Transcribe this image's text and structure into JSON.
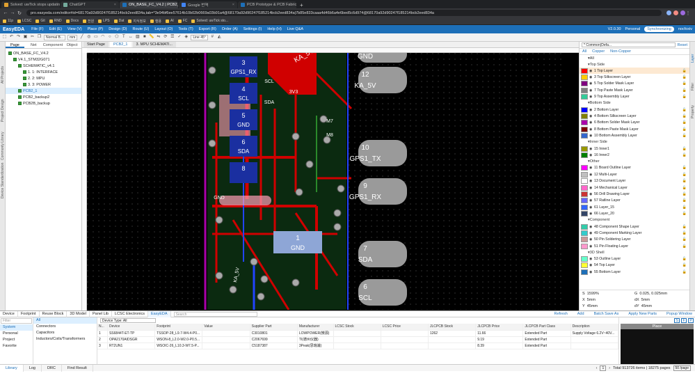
{
  "browser": {
    "tabs": [
      {
        "label": "Solved: uwTick stops updating...",
        "color": "#e0a030",
        "active": false
      },
      {
        "label": "ChatGPT",
        "color": "#74aa9c",
        "active": false
      },
      {
        "label": "ON_BASE_FC_V4.2 | PCB2_1 | Ea...",
        "color": "#1d6fb8",
        "active": true
      },
      {
        "label": "Google 번역",
        "color": "#4285f4",
        "active": false
      },
      {
        "label": "PCB Prototype & PCB Fabricati...",
        "color": "#1d6fb8",
        "active": false
      }
    ],
    "new_tab": "+",
    "url": "pro.easyeda.com/editor#id=68170a92d90247f185214bcb2eed834a,tab=*3e94bf6ee57614b10b02b0669a03b91a4@68170a92d90247f185214bcb2eed834a|7b85e833caaa4d46b6a4e6bed5c6d974@68170a92d90247f185214bcb2eed834a",
    "bookmarks": [
      "11p",
      "LCSC",
      "Git",
      "RND",
      "Docs",
      "전원",
      "LPS",
      "Dat",
      "지식정보",
      "행용",
      "AI",
      "FC",
      "Solved: uwTick sto..."
    ]
  },
  "app": {
    "logo": "EasyEDA",
    "menus": [
      "File (F)",
      "Edit (E)",
      "View (V)",
      "Place (P)",
      "Design (D)",
      "Route (U)",
      "Layout (O)",
      "Tools (T)",
      "Export (R)",
      "Order (A)",
      "Settings (I)",
      "Help (H)",
      "Live Q&A"
    ],
    "version": "V2.0.30",
    "plan": "Personal",
    "sync": "Synchronizing",
    "user": "nocfoxiv"
  },
  "toolbar": {
    "mode": "Normal B...",
    "unit": "mm",
    "line": "Line 45°"
  },
  "left_vert": [
    "All Projects",
    "Project Design",
    "Commonly Library",
    "Device Standardization"
  ],
  "left_tabs": [
    "Page",
    "Net",
    "Component",
    "Object"
  ],
  "tree": [
    {
      "label": "ON_BASE_FC_V4.2",
      "indent": 0,
      "sel": false
    },
    {
      "label": "V4.1_STM32G071",
      "indent": 1,
      "sel": false
    },
    {
      "label": "SCHEMATIC_v4.1",
      "indent": 2,
      "sel": false
    },
    {
      "label": "1. 1: INTERFACE",
      "indent": 3,
      "sel": false
    },
    {
      "label": "2. 2: MPU",
      "indent": 3,
      "sel": false
    },
    {
      "label": "3. 3: POWER",
      "indent": 3,
      "sel": false
    },
    {
      "label": "PCB2_1",
      "indent": 2,
      "sel": true
    },
    {
      "label": "PCB2_backup2",
      "indent": 2,
      "sel": false
    },
    {
      "label": "PCB2B_backup",
      "indent": 2,
      "sel": false
    }
  ],
  "canvas_tabs": [
    "Start Page",
    "PCB2_1",
    "3. MPU SCHEMATI..."
  ],
  "pcb": {
    "pads_right": [
      {
        "num": "12",
        "net": "KA_5V"
      },
      {
        "num": "10",
        "net": "GPS1_TX"
      },
      {
        "num": "9",
        "net": "GPS1_RX"
      },
      {
        "num": "7",
        "net": "SDA"
      },
      {
        "num": "6",
        "net": "SCL"
      }
    ],
    "pads_left": [
      {
        "num": "3",
        "net": "GPS1_RX"
      },
      {
        "num": "4",
        "net": "SCL"
      },
      {
        "num": "5",
        "net": "GND"
      },
      {
        "num": "6",
        "net": "SDA"
      },
      {
        "num": "8",
        "net": ""
      }
    ],
    "big_pad": {
      "num": "1",
      "net": "GND"
    },
    "top_label": "KA_5V",
    "top_right": "GND",
    "mid_labels": [
      "SCL",
      "SDA",
      "3V3",
      "M7",
      "M8",
      "GND"
    ],
    "vert_label": "KA_5V"
  },
  "layers": {
    "preset": "* Common(Defa...",
    "reset": "Reset",
    "filters": [
      "All",
      "Copper",
      "Non-Copper"
    ],
    "groups": [
      {
        "name": "All",
        "rows": []
      },
      {
        "name": "Top Side",
        "rows": [
          {
            "name": "1 Top Layer",
            "color": "#ff0000",
            "active": true
          },
          {
            "name": "3 Top Silkscreen Layer",
            "color": "#ffcc00"
          },
          {
            "name": "5 Top Solder Mask Layer",
            "color": "#800080"
          },
          {
            "name": "7 Top Paste Mask Layer",
            "color": "#808080"
          },
          {
            "name": "9 Top Assembly Layer",
            "color": "#33cc99"
          }
        ]
      },
      {
        "name": "Bottom Side",
        "rows": [
          {
            "name": "2 Bottom Layer",
            "color": "#0000ff"
          },
          {
            "name": "4 Bottom Silkscreen Layer",
            "color": "#808000"
          },
          {
            "name": "6 Bottom Solder Mask Layer",
            "color": "#aa00aa"
          },
          {
            "name": "8 Bottom Paste Mask Layer",
            "color": "#800000"
          },
          {
            "name": "10 Bottom Assembly Layer",
            "color": "#3366cc"
          }
        ]
      },
      {
        "name": "Inner Side",
        "rows": [
          {
            "name": "15 Inner1",
            "color": "#999900"
          },
          {
            "name": "16 Inner2",
            "color": "#008000"
          }
        ]
      },
      {
        "name": "Other",
        "rows": [
          {
            "name": "11 Board Outline Layer",
            "color": "#ff00ff"
          },
          {
            "name": "12 Multi-Layer",
            "color": "#c0c0c0"
          },
          {
            "name": "13 Document Layer",
            "color": "#ffffff"
          },
          {
            "name": "14 Mechanical Layer",
            "color": "#ff66cc"
          },
          {
            "name": "56 Drill Drawing Layer",
            "color": "#cc3333"
          },
          {
            "name": "57 Ratline Layer",
            "color": "#6666ff"
          },
          {
            "name": "61 Layer_15",
            "color": "#3366ff"
          },
          {
            "name": "66 Layer_20",
            "color": "#334466"
          }
        ]
      },
      {
        "name": "Component",
        "rows": [
          {
            "name": "48 Component Shape Layer",
            "color": "#33ccaa"
          },
          {
            "name": "49 Component Marking Layer",
            "color": "#33cccc"
          },
          {
            "name": "50 Pin Soldering Layer",
            "color": "#cc9999"
          },
          {
            "name": "51 Pin Floating Layer",
            "color": "#ff99cc"
          }
        ]
      },
      {
        "name": "3D Shell",
        "rows": [
          {
            "name": "53 Outline Layer",
            "color": "#66ffcc"
          },
          {
            "name": "54 Top Layer",
            "color": "#ffff33"
          },
          {
            "name": "55 Bottom Layer",
            "color": "#1d6fb8"
          }
        ]
      }
    ]
  },
  "coords": {
    "s_label": "S",
    "s": "1599%",
    "g_label": "G",
    "g": "0.025, 0.025mm",
    "x_label": "X",
    "x": "5mm",
    "dx_label": "dX",
    "dx": "5mm",
    "y_label": "Y",
    "y": "45mm",
    "dy_label": "dY",
    "dy": "45mm"
  },
  "right_vert": [
    "Layer",
    "Filter",
    "Property"
  ],
  "bottom": {
    "tabs": [
      "Device",
      "Footprint",
      "Reuse Block",
      "3D Model",
      "Panel Lib",
      "LCSC Electronics",
      "EasyEDA"
    ],
    "active_tab": "EasyEDA",
    "search_placeholder": "Search",
    "actions": [
      "Refresh",
      "Add",
      "Batch Save As",
      "Apply New Parts",
      "Popup Window"
    ],
    "filter_placeholder": "Filter",
    "cats": [
      "System",
      "Personal",
      "Project",
      "Favorite"
    ],
    "subcats": [
      "All",
      "Connectors",
      "Capacitors",
      "Inductors/Coils/Transformers"
    ],
    "device_type": "Device Type: All",
    "columns": [
      "N...",
      "Device",
      "Footprint",
      "Value",
      "Supplier Part",
      "Manufacturer",
      "LCSC Stock",
      "LCSC Price",
      "JLCPCB Stock",
      "JLCPCB Price",
      "JLCPCB Part Class",
      "Description"
    ],
    "rows": [
      [
        "1",
        "SS6844T-ET-TP",
        "TSSOP-28_L9.7-W4.4-P0...",
        "",
        "C3010801",
        "LOWPOWER(微源)",
        "",
        "",
        "1262",
        "11.66",
        "Extended Part",
        "Supply Voltage 6.2V~40V..."
      ],
      [
        "2",
        "OPA2170AIDSGR",
        "WSON-8_L2.0-W2.0-P0.5...",
        "",
        "C2067699",
        "TI(德州仪器)",
        "",
        "",
        "",
        "9.19",
        "Extended Part",
        ""
      ],
      [
        "3",
        "RT2UN1",
        "WSOIC-26_L10.3-W7.5-P...",
        "",
        "C5187387",
        "3Peak(思瑞浦)",
        "",
        "",
        "",
        "8.39",
        "Extended Part",
        ""
      ]
    ],
    "preview_tabs": [
      "S",
      "F",
      "P"
    ],
    "preview_title": "Place"
  },
  "status": {
    "tabs": [
      "Library",
      "Log",
      "DRC",
      "Find Result"
    ],
    "page": "1",
    "total": "Total 913726 items | 18275 pages",
    "per": "50 /page"
  }
}
